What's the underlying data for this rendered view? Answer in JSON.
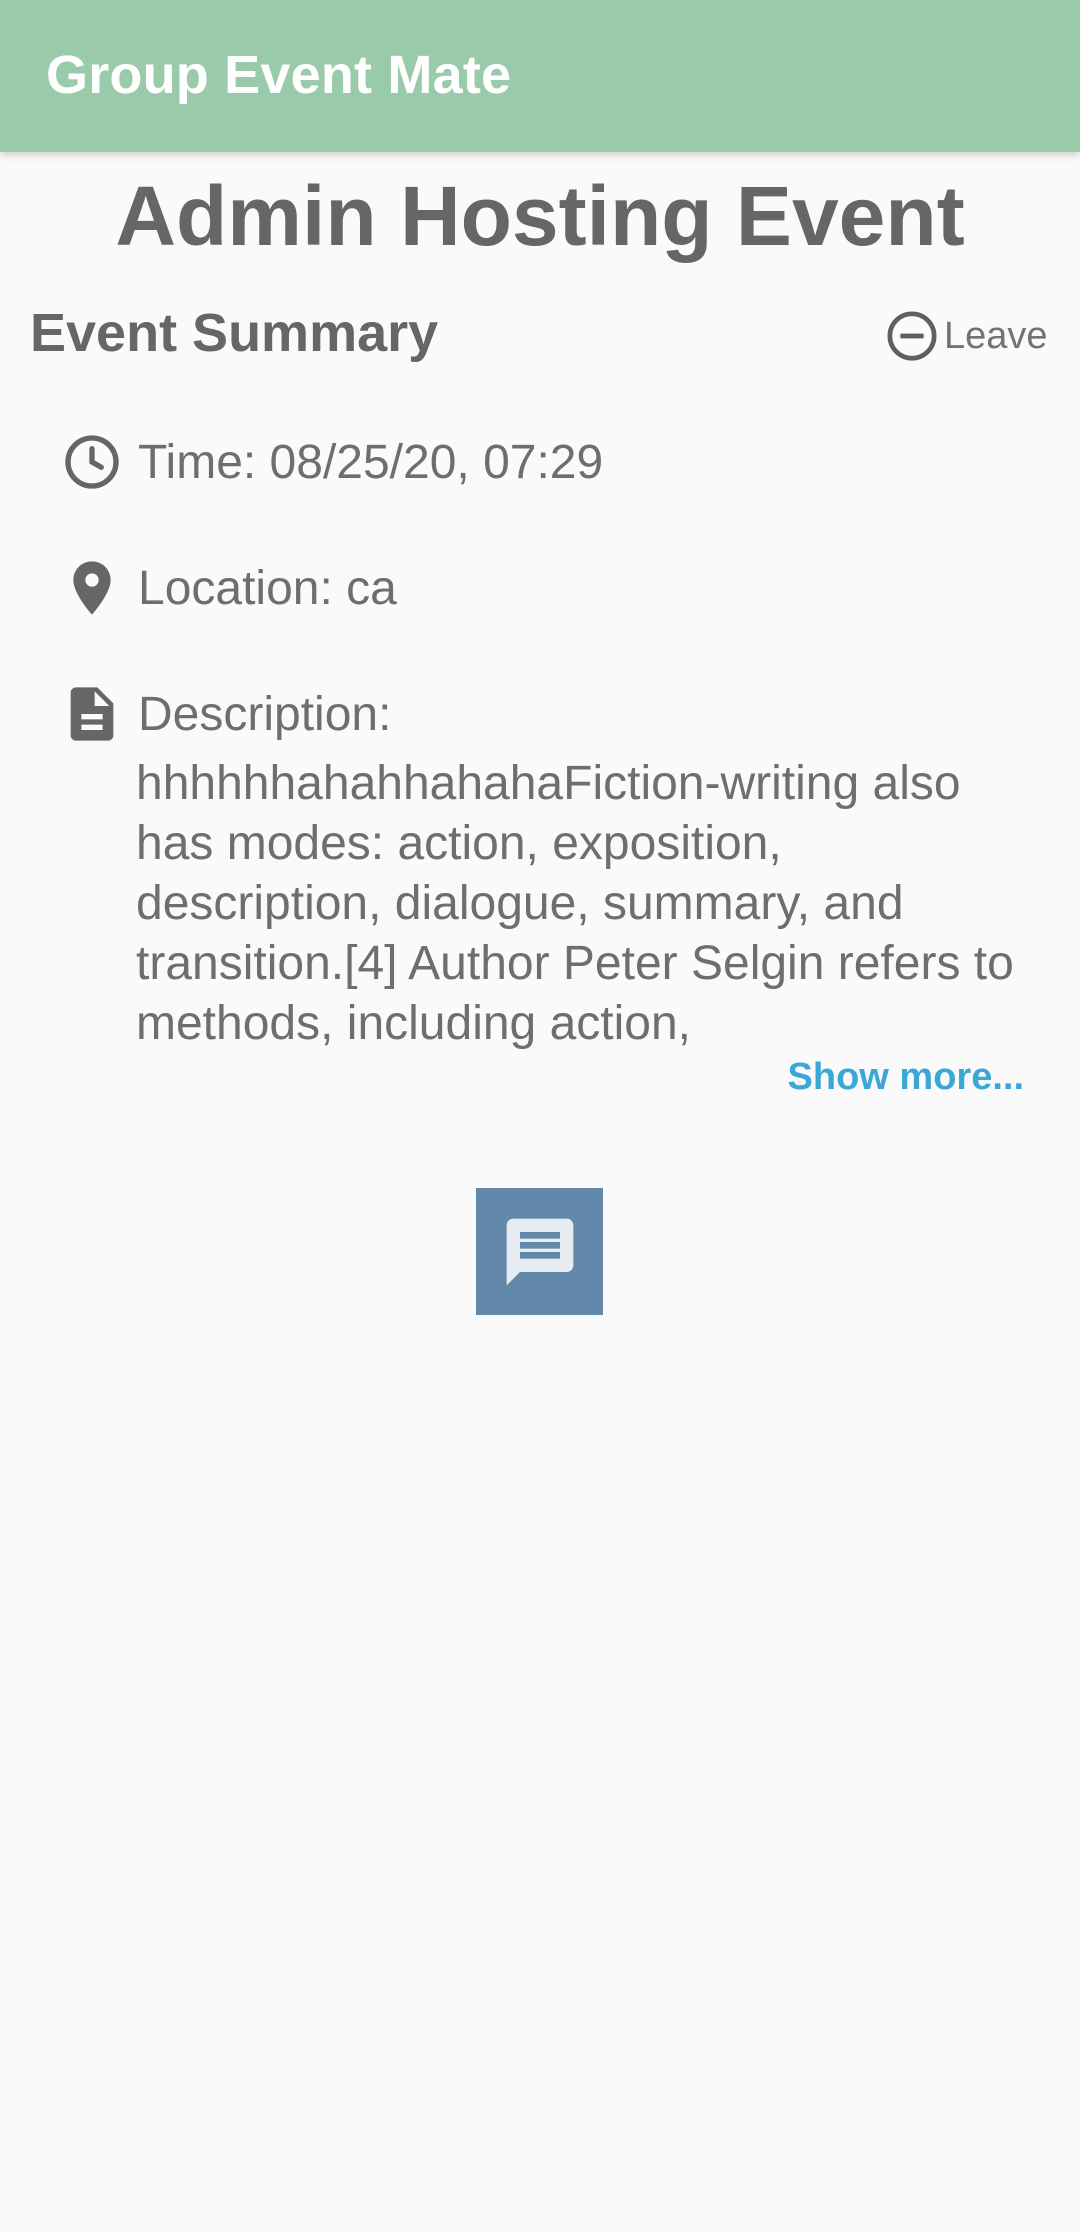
{
  "app_bar": {
    "title": "Group Event Mate",
    "color": "#99cbab"
  },
  "page": {
    "title": "Admin Hosting Event"
  },
  "summary": {
    "heading": "Event Summary",
    "leave_label": "Leave",
    "leave_icon": "minus-circle-icon"
  },
  "details": {
    "time": {
      "icon": "clock-icon",
      "text": "Time: 08/25/20, 07:29"
    },
    "location": {
      "icon": "location-pin-icon",
      "text": "Location: ca"
    },
    "description": {
      "icon": "document-icon",
      "label": "Description:",
      "text": "hhhhhhahahhahahaFiction-writing also has modes: action, exposition, description, dialogue, summary, and transition.[4] Author Peter Selgin refers to methods, including action,",
      "show_more": "Show more..."
    }
  },
  "chat_button": {
    "icon": "chat-icon",
    "color": "#6289a9"
  },
  "colors": {
    "background": "#fafafa",
    "text": "#6e6e6e",
    "link": "#3aa7d6"
  }
}
